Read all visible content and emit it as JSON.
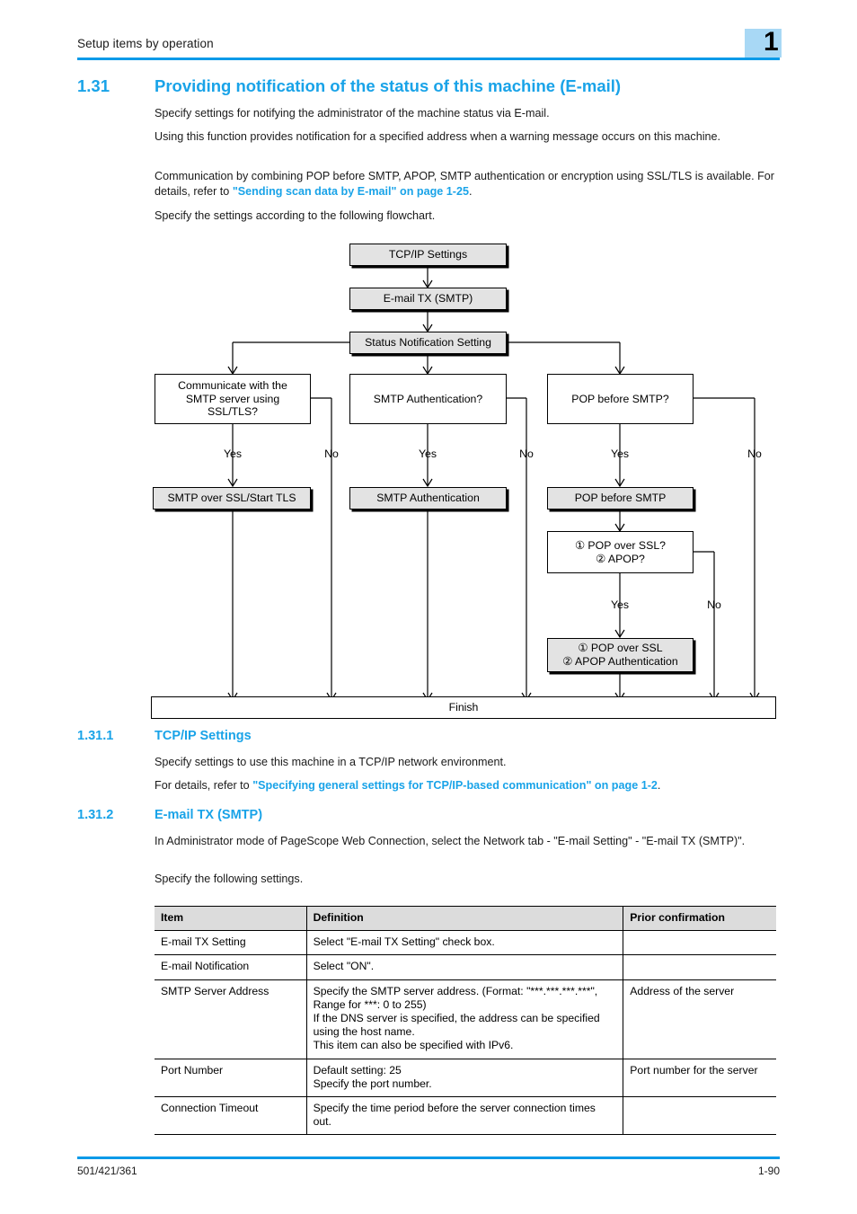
{
  "header": {
    "running_title": "Setup items by operation",
    "chapter_number": "1",
    "tab_color": "#a8d8f5",
    "rule_color": "#0a9ae8"
  },
  "section": {
    "number": "1.31",
    "title": "Providing notification of the status of this machine (E-mail)",
    "heading_color": "#19A3E8",
    "paragraphs": [
      "Specify settings for notifying the administrator of the machine status via E-mail.",
      "Using this function provides notification for a specified address when a warning message occurs on this machine.",
      "Specify the settings according to the following flowchart."
    ],
    "para_with_link": {
      "before": "Communication by combining POP before SMTP, APOP, SMTP authentication or encryption using SSL/TLS is available. For details, refer to ",
      "link": "\"Sending scan data by E-mail\" on page 1-25",
      "after": "."
    }
  },
  "flowchart": {
    "nodes": {
      "tcpip_settings": "TCP/IP Settings",
      "email_tx_smtp": "E-mail TX (SMTP)",
      "status_notification": "Status Notification Setting",
      "decision_ssl": "Communicate with the SMTP server using SSL/TLS?",
      "decision_smtp_auth": "SMTP Authentication?",
      "decision_pop_before_smtp": "POP before SMTP?",
      "action_smtp_over_ssl": "SMTP over SSL/Start TLS",
      "action_smtp_auth": "SMTP Authentication",
      "action_pop_before_smtp": "POP before SMTP",
      "decision_pop_ssl_apop_1": "① POP over SSL?",
      "decision_pop_ssl_apop_2": "② APOP?",
      "action_pop_ssl_apop_1": "① POP over SSL",
      "action_pop_ssl_apop_2": "② APOP Authentication",
      "finish": "Finish"
    },
    "branch_labels": {
      "ssl_yes": "Yes",
      "ssl_no": "No",
      "smtpauth_yes": "Yes",
      "smtpauth_no": "No",
      "pop_yes": "Yes",
      "pop_no": "No",
      "popssl_yes": "Yes",
      "popssl_no": "No"
    },
    "decision_ssl_lines": [
      "Communicate with the",
      "SMTP server using",
      "SSL/TLS?"
    ]
  },
  "subsection_1": {
    "number": "1.31.1",
    "title": "TCP/IP Settings",
    "paragraph": "Specify settings to use this machine in a TCP/IP network environment.",
    "link_para": {
      "before": "For details, refer to ",
      "link": "\"Specifying general settings for TCP/IP-based communication\" on page 1-2",
      "after": "."
    }
  },
  "subsection_2": {
    "number": "1.31.2",
    "title": "E-mail TX (SMTP)",
    "paragraph_1": "In Administrator mode of PageScope Web Connection, select the Network tab - \"E-mail Setting\" - \"E-mail TX (SMTP)\".",
    "paragraph_2": "Specify the following settings."
  },
  "table": {
    "headers": [
      "Item",
      "Definition",
      "Prior confirmation"
    ],
    "rows": [
      {
        "item": "E-mail TX Setting",
        "definition": "Select \"E-mail TX Setting\" check box.",
        "prior": ""
      },
      {
        "item": "E-mail Notification",
        "definition": "Select \"ON\".",
        "prior": ""
      },
      {
        "item": "SMTP Server Address",
        "definition": "Specify the SMTP server address. (Format: \"***.***.***.***\", Range for ***: 0 to 255)\nIf the DNS server is specified, the address can be specified using the host name.\nThis item can also be specified with IPv6.",
        "prior": "Address of the server"
      },
      {
        "item": "Port Number",
        "definition": "Default setting: 25\nSpecify the port number.",
        "prior": "Port number for the server"
      },
      {
        "item": "Connection Timeout",
        "definition": "Specify the time period before the server connection times out.",
        "prior": ""
      }
    ]
  },
  "footer": {
    "left": "501/421/361",
    "right": "1-90"
  }
}
